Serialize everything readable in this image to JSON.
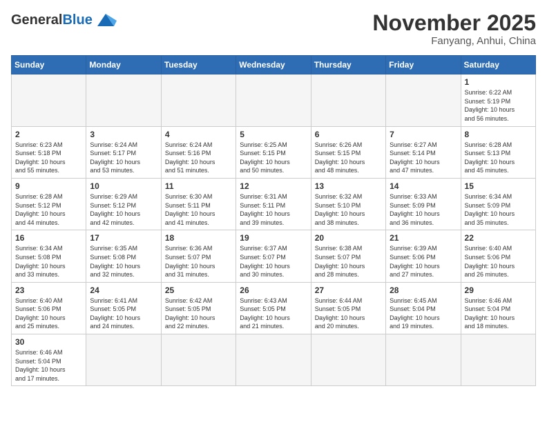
{
  "header": {
    "logo_general": "General",
    "logo_blue": "Blue",
    "month_title": "November 2025",
    "subtitle": "Fanyang, Anhui, China"
  },
  "weekdays": [
    "Sunday",
    "Monday",
    "Tuesday",
    "Wednesday",
    "Thursday",
    "Friday",
    "Saturday"
  ],
  "days": {
    "d1": {
      "num": "1",
      "info": "Sunrise: 6:22 AM\nSunset: 5:19 PM\nDaylight: 10 hours\nand 56 minutes."
    },
    "d2": {
      "num": "2",
      "info": "Sunrise: 6:23 AM\nSunset: 5:18 PM\nDaylight: 10 hours\nand 55 minutes."
    },
    "d3": {
      "num": "3",
      "info": "Sunrise: 6:24 AM\nSunset: 5:17 PM\nDaylight: 10 hours\nand 53 minutes."
    },
    "d4": {
      "num": "4",
      "info": "Sunrise: 6:24 AM\nSunset: 5:16 PM\nDaylight: 10 hours\nand 51 minutes."
    },
    "d5": {
      "num": "5",
      "info": "Sunrise: 6:25 AM\nSunset: 5:15 PM\nDaylight: 10 hours\nand 50 minutes."
    },
    "d6": {
      "num": "6",
      "info": "Sunrise: 6:26 AM\nSunset: 5:15 PM\nDaylight: 10 hours\nand 48 minutes."
    },
    "d7": {
      "num": "7",
      "info": "Sunrise: 6:27 AM\nSunset: 5:14 PM\nDaylight: 10 hours\nand 47 minutes."
    },
    "d8": {
      "num": "8",
      "info": "Sunrise: 6:28 AM\nSunset: 5:13 PM\nDaylight: 10 hours\nand 45 minutes."
    },
    "d9": {
      "num": "9",
      "info": "Sunrise: 6:28 AM\nSunset: 5:12 PM\nDaylight: 10 hours\nand 44 minutes."
    },
    "d10": {
      "num": "10",
      "info": "Sunrise: 6:29 AM\nSunset: 5:12 PM\nDaylight: 10 hours\nand 42 minutes."
    },
    "d11": {
      "num": "11",
      "info": "Sunrise: 6:30 AM\nSunset: 5:11 PM\nDaylight: 10 hours\nand 41 minutes."
    },
    "d12": {
      "num": "12",
      "info": "Sunrise: 6:31 AM\nSunset: 5:11 PM\nDaylight: 10 hours\nand 39 minutes."
    },
    "d13": {
      "num": "13",
      "info": "Sunrise: 6:32 AM\nSunset: 5:10 PM\nDaylight: 10 hours\nand 38 minutes."
    },
    "d14": {
      "num": "14",
      "info": "Sunrise: 6:33 AM\nSunset: 5:09 PM\nDaylight: 10 hours\nand 36 minutes."
    },
    "d15": {
      "num": "15",
      "info": "Sunrise: 6:34 AM\nSunset: 5:09 PM\nDaylight: 10 hours\nand 35 minutes."
    },
    "d16": {
      "num": "16",
      "info": "Sunrise: 6:34 AM\nSunset: 5:08 PM\nDaylight: 10 hours\nand 33 minutes."
    },
    "d17": {
      "num": "17",
      "info": "Sunrise: 6:35 AM\nSunset: 5:08 PM\nDaylight: 10 hours\nand 32 minutes."
    },
    "d18": {
      "num": "18",
      "info": "Sunrise: 6:36 AM\nSunset: 5:07 PM\nDaylight: 10 hours\nand 31 minutes."
    },
    "d19": {
      "num": "19",
      "info": "Sunrise: 6:37 AM\nSunset: 5:07 PM\nDaylight: 10 hours\nand 30 minutes."
    },
    "d20": {
      "num": "20",
      "info": "Sunrise: 6:38 AM\nSunset: 5:07 PM\nDaylight: 10 hours\nand 28 minutes."
    },
    "d21": {
      "num": "21",
      "info": "Sunrise: 6:39 AM\nSunset: 5:06 PM\nDaylight: 10 hours\nand 27 minutes."
    },
    "d22": {
      "num": "22",
      "info": "Sunrise: 6:40 AM\nSunset: 5:06 PM\nDaylight: 10 hours\nand 26 minutes."
    },
    "d23": {
      "num": "23",
      "info": "Sunrise: 6:40 AM\nSunset: 5:06 PM\nDaylight: 10 hours\nand 25 minutes."
    },
    "d24": {
      "num": "24",
      "info": "Sunrise: 6:41 AM\nSunset: 5:05 PM\nDaylight: 10 hours\nand 24 minutes."
    },
    "d25": {
      "num": "25",
      "info": "Sunrise: 6:42 AM\nSunset: 5:05 PM\nDaylight: 10 hours\nand 22 minutes."
    },
    "d26": {
      "num": "26",
      "info": "Sunrise: 6:43 AM\nSunset: 5:05 PM\nDaylight: 10 hours\nand 21 minutes."
    },
    "d27": {
      "num": "27",
      "info": "Sunrise: 6:44 AM\nSunset: 5:05 PM\nDaylight: 10 hours\nand 20 minutes."
    },
    "d28": {
      "num": "28",
      "info": "Sunrise: 6:45 AM\nSunset: 5:04 PM\nDaylight: 10 hours\nand 19 minutes."
    },
    "d29": {
      "num": "29",
      "info": "Sunrise: 6:46 AM\nSunset: 5:04 PM\nDaylight: 10 hours\nand 18 minutes."
    },
    "d30": {
      "num": "30",
      "info": "Sunrise: 6:46 AM\nSunset: 5:04 PM\nDaylight: 10 hours\nand 17 minutes."
    }
  }
}
